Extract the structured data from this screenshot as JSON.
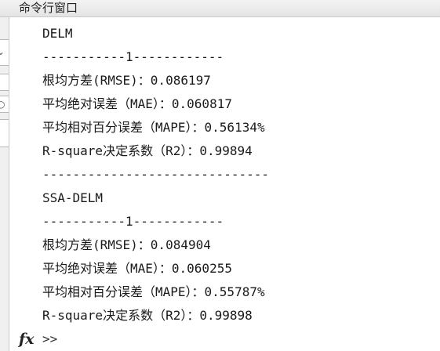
{
  "window": {
    "title": "命令行窗口"
  },
  "console": {
    "lines": [
      "DELM",
      "-----------1------------",
      "根均方差(RMSE)：0.086197",
      "平均绝对误差（MAE）：0.060817",
      "平均相对百分误差（MAPE）：0.56134%",
      "R-square决定系数（R2）：0.99894",
      "------------------------------",
      "SSA-DELM",
      "-----------1------------",
      "根均方差(RMSE)：0.084904",
      "平均绝对误差（MAE）：0.060255",
      "平均相对百分误差（MAPE）：0.55787%",
      "R-square决定系数（R2）：0.99898"
    ]
  },
  "prompt": {
    "icon": "fx-icon",
    "symbol": ">>"
  },
  "colors": {
    "background": "#ffffff",
    "text": "#1a1a1a",
    "title_bar": "#ececec"
  }
}
